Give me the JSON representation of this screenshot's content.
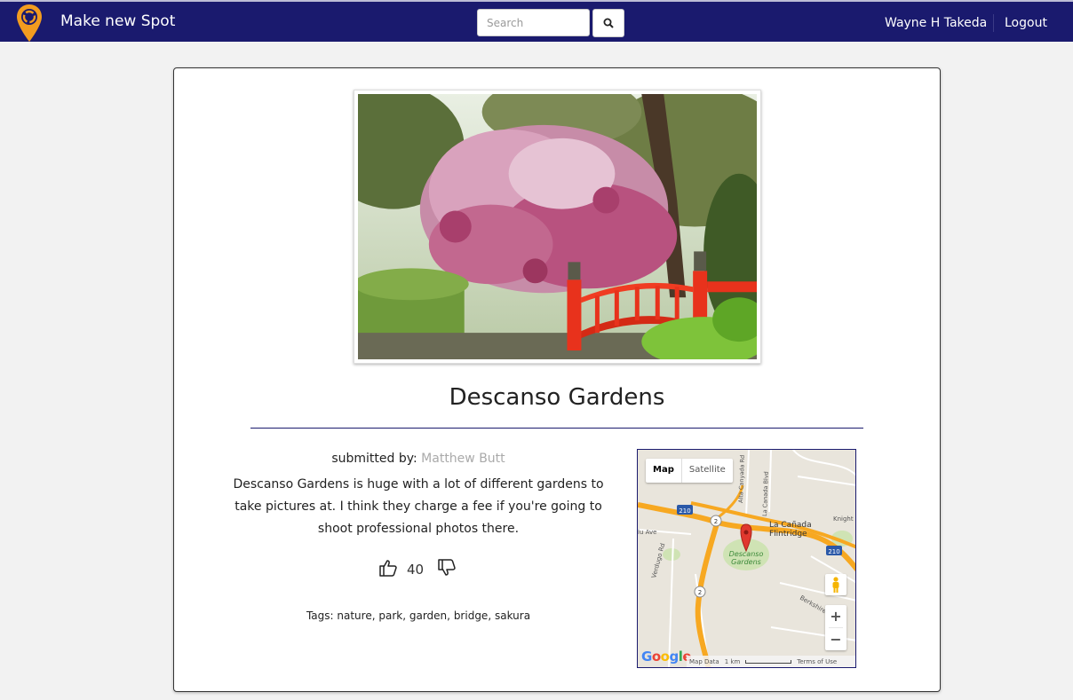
{
  "navbar": {
    "brand": "Make new Spot",
    "search_placeholder": "Search",
    "user_name": "Wayne H Takeda",
    "logout_label": "Logout",
    "bg_color": "#1a1a6e",
    "logo_color": "#f39c1f"
  },
  "spot": {
    "title": "Descanso Gardens",
    "submitted_by_label": "submitted by:",
    "author": "Matthew Butt",
    "description": "Descanso Gardens is huge with a lot of different gardens to take pictures at. I think they charge a fee if you're going to shoot professional photos there.",
    "vote_count": "40",
    "tags_label": "Tags:",
    "tags": [
      "nature",
      "park",
      "garden",
      "bridge",
      "sakura"
    ]
  },
  "map": {
    "tabs": [
      "Map",
      "Satellite"
    ],
    "labels": {
      "place_line1": "Descanso",
      "place_line2": "Gardens",
      "la_canada": "La Cañada",
      "flintridge": "Flintridge",
      "alta_canyada": "Alta Canyada Rd",
      "la_canada_blvd": "La Canada Blvd",
      "knight": "Knight",
      "berkshire": "Berkshire",
      "verdugo": "Verdugo Rd",
      "ave": "lu Ave",
      "shield_210_a": "210",
      "shield_210_b": "210",
      "shield_2_a": "2",
      "shield_2_b": "2"
    },
    "zoom_in": "+",
    "zoom_out": "−",
    "google_logo": "Google",
    "footer_map_data": "Map Data",
    "footer_scale": "1 km",
    "footer_terms": "Terms of Use"
  }
}
